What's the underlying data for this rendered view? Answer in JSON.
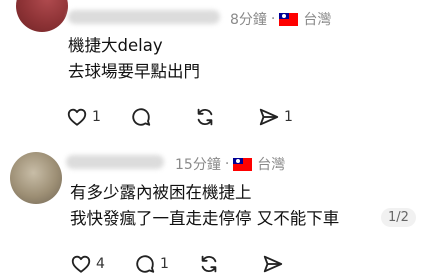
{
  "comments": [
    {
      "time": "8分鐘",
      "location": "台灣",
      "text_lines": [
        "機捷大delay",
        "去球場要早點出門"
      ],
      "likes": "1",
      "replies": "",
      "reposts": "",
      "shares": "1"
    },
    {
      "time": "15分鐘",
      "location": "台灣",
      "text_lines": [
        "有多少露內被困在機捷上",
        "我快發瘋了一直走走停停 又不能下車"
      ],
      "page_indicator": "1/2",
      "likes": "4",
      "replies": "1",
      "reposts": "",
      "shares": ""
    }
  ],
  "separator": "·",
  "icons": [
    "heart-icon",
    "comment-icon",
    "repost-icon",
    "share-icon"
  ],
  "colors": {
    "meta_gray": "#8a8a8a",
    "flag_red": "#fe0000",
    "flag_blue": "#000095"
  }
}
